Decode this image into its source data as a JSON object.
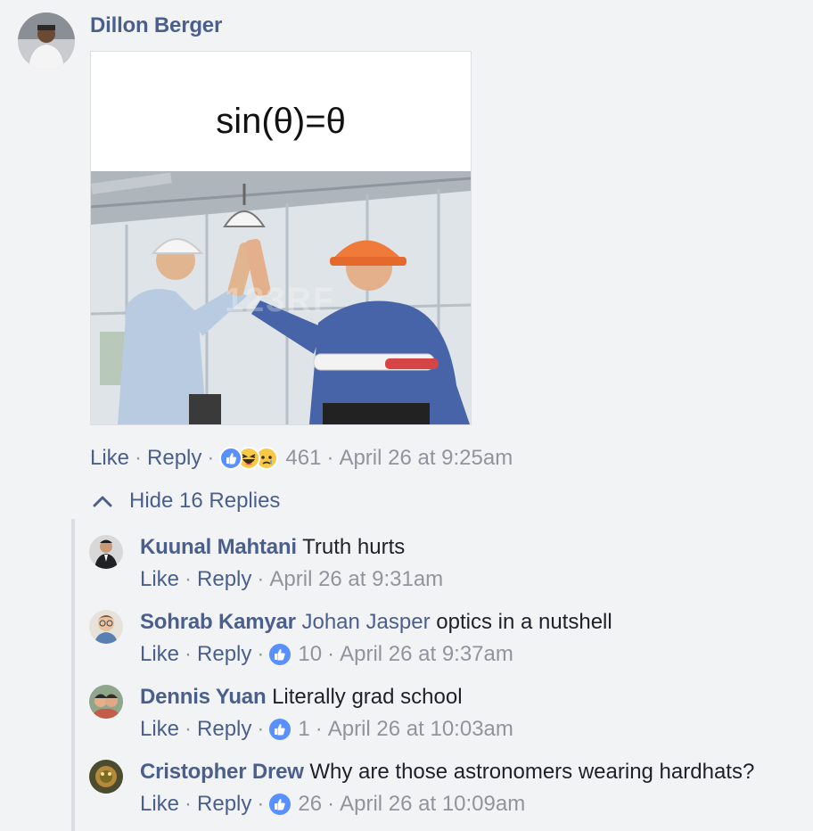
{
  "comment": {
    "author": "Dillon Berger",
    "image": {
      "caption": "sin(θ)=θ",
      "watermark": "123RF"
    },
    "actions": {
      "like": "Like",
      "reply": "Reply"
    },
    "reactions_count": "461",
    "timestamp": "April 26 at 9:25am"
  },
  "replies_toggle": {
    "label": "Hide 16 Replies"
  },
  "replies": [
    {
      "author": "Kuunal Mahtani",
      "mention": "",
      "text": "Truth hurts",
      "like": "Like",
      "reply": "Reply",
      "count": "",
      "timestamp": "April 26 at 9:31am"
    },
    {
      "author": "Sohrab Kamyar",
      "mention": "Johan Jasper",
      "text": "optics in a nutshell",
      "like": "Like",
      "reply": "Reply",
      "count": "10",
      "timestamp": "April 26 at 9:37am"
    },
    {
      "author": "Dennis Yuan",
      "mention": "",
      "text": "Literally grad school",
      "like": "Like",
      "reply": "Reply",
      "count": "1",
      "timestamp": "April 26 at 10:03am"
    },
    {
      "author": "Cristopher Drew",
      "mention": "",
      "text": "Why are those astronomers wearing hardhats?",
      "like": "Like",
      "reply": "Reply",
      "count": "26",
      "timestamp": "April 26 at 10:09am"
    }
  ],
  "colors": {
    "link": "#4b5f8c",
    "meta": "#90949c",
    "like_blue": "#5890ff",
    "background": "#f2f3f5"
  }
}
